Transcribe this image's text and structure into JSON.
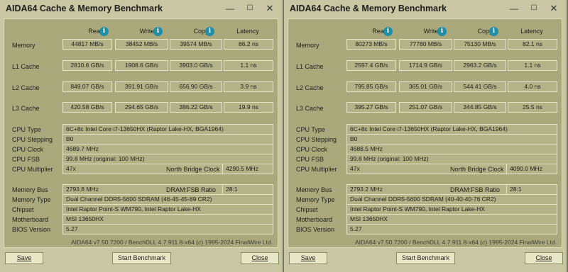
{
  "headers": {
    "read": "Read",
    "write": "Write",
    "copy": "Copy",
    "latency": "Latency"
  },
  "row_labels": {
    "memory": "Memory",
    "l1": "L1 Cache",
    "l2": "L2 Cache",
    "l3": "L3 Cache"
  },
  "info_labels": {
    "cpu_type": "CPU Type",
    "cpu_stepping": "CPU Stepping",
    "cpu_clock": "CPU Clock",
    "cpu_fsb": "CPU FSB",
    "cpu_multiplier": "CPU Multiplier",
    "north_bridge_clock": "North Bridge Clock",
    "memory_bus": "Memory Bus",
    "dram_fsb_ratio": "DRAM:FSB Ratio",
    "memory_type": "Memory Type",
    "chipset": "Chipset",
    "motherboard": "Motherboard",
    "bios_version": "BIOS Version"
  },
  "windows": [
    {
      "title": "AIDA64 Cache & Memory Benchmark",
      "memory": {
        "read": "44817 MB/s",
        "write": "38452 MB/s",
        "copy": "39574 MB/s",
        "latency": "86.2 ns"
      },
      "l1": {
        "read": "2810.6 GB/s",
        "write": "1908.6 GB/s",
        "copy": "3903.0 GB/s",
        "latency": "1.1 ns"
      },
      "l2": {
        "read": "849.07 GB/s",
        "write": "391.91 GB/s",
        "copy": "656.90 GB/s",
        "latency": "3.9 ns"
      },
      "l3": {
        "read": "420.58 GB/s",
        "write": "294.65 GB/s",
        "copy": "386.22 GB/s",
        "latency": "19.9 ns"
      },
      "cpu_type": "6C+8c Intel Core i7-13650HX  (Raptor Lake-HX, BGA1964)",
      "cpu_stepping": "B0",
      "cpu_clock": "4689.7 MHz",
      "cpu_fsb": "99.8 MHz  (original: 100 MHz)",
      "cpu_multiplier": "47x",
      "north_bridge_clock": "4290.5 MHz",
      "memory_bus": "2793.8 MHz",
      "dram_fsb_ratio": "28:1",
      "memory_type": "Dual Channel DDR5-5600 SDRAM  (46-45-45-89 CR2)",
      "chipset": "Intel Raptor Point-S WM790, Intel Raptor Lake-HX",
      "motherboard": "MSI 13650HX",
      "bios_version": "5.27",
      "footer": "AIDA64 v7.50.7200 / BenchDLL 4.7.911.8-x64  (c) 1995-2024 FinalWire Ltd.",
      "buttons": {
        "save": "Save",
        "start": "Start Benchmark",
        "close": "Close"
      }
    },
    {
      "title": "AIDA64 Cache & Memory Benchmark",
      "memory": {
        "read": "80273 MB/s",
        "write": "77780 MB/s",
        "copy": "75130 MB/s",
        "latency": "82.1 ns"
      },
      "l1": {
        "read": "2597.4 GB/s",
        "write": "1714.9 GB/s",
        "copy": "2963.2 GB/s",
        "latency": "1.1 ns"
      },
      "l2": {
        "read": "795.85 GB/s",
        "write": "365.01 GB/s",
        "copy": "544.41 GB/s",
        "latency": "4.0 ns"
      },
      "l3": {
        "read": "395.27 GB/s",
        "write": "251.07 GB/s",
        "copy": "344.85 GB/s",
        "latency": "25.5 ns"
      },
      "cpu_type": "6C+8c Intel Core i7-13650HX  (Raptor Lake-HX, BGA1964)",
      "cpu_stepping": "B0",
      "cpu_clock": "4688.5 MHz",
      "cpu_fsb": "99.8 MHz  (original: 100 MHz)",
      "cpu_multiplier": "47x",
      "north_bridge_clock": "4090.0 MHz",
      "memory_bus": "2793.2 MHz",
      "dram_fsb_ratio": "28:1",
      "memory_type": "Dual Channel DDR5-5600 SDRAM  (40-40-40-76 CR2)",
      "chipset": "Intel Raptor Point-S WM790, Intel Raptor Lake-HX",
      "motherboard": "MSI 13650HX",
      "bios_version": "5.27",
      "footer": "AIDA64 v7.50.7200 / BenchDLL 4.7.911.8-x64  (c) 1995-2024 FinalWire Ltd.",
      "buttons": {
        "save": "Save",
        "start": "Start Benchmark",
        "close": "Close"
      }
    }
  ]
}
